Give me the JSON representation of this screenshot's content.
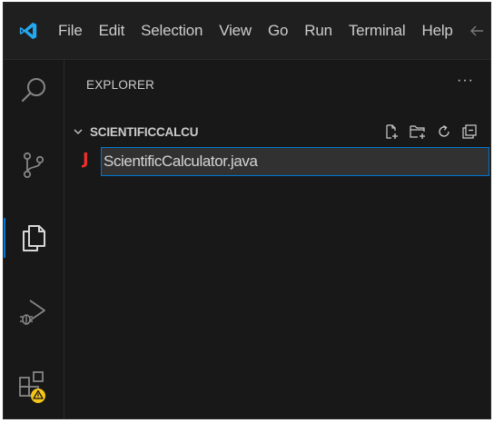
{
  "menu": [
    "File",
    "Edit",
    "Selection",
    "View",
    "Go",
    "Run",
    "Terminal",
    "Help"
  ],
  "colors": {
    "accent": "#0078d4",
    "java": "#e9302a",
    "warning_badge": "#f5c518",
    "vscode_logo": "#23a9f2"
  },
  "activitybar": {
    "items": [
      {
        "icon": "search-icon"
      },
      {
        "icon": "source-control-icon"
      },
      {
        "icon": "explorer-icon",
        "active": true
      },
      {
        "icon": "run-debug-icon"
      },
      {
        "icon": "extensions-icon",
        "badge": "warning"
      }
    ]
  },
  "sidebar": {
    "title": "EXPLORER",
    "more": "···",
    "folder": {
      "name": "SCIENTIFICCALCU",
      "expanded": true,
      "actions": [
        "new-file-icon",
        "new-folder-icon",
        "refresh-icon",
        "collapse-all-icon"
      ]
    },
    "file": {
      "icon": "J",
      "rename_value": "ScientificCalculator.java"
    }
  }
}
